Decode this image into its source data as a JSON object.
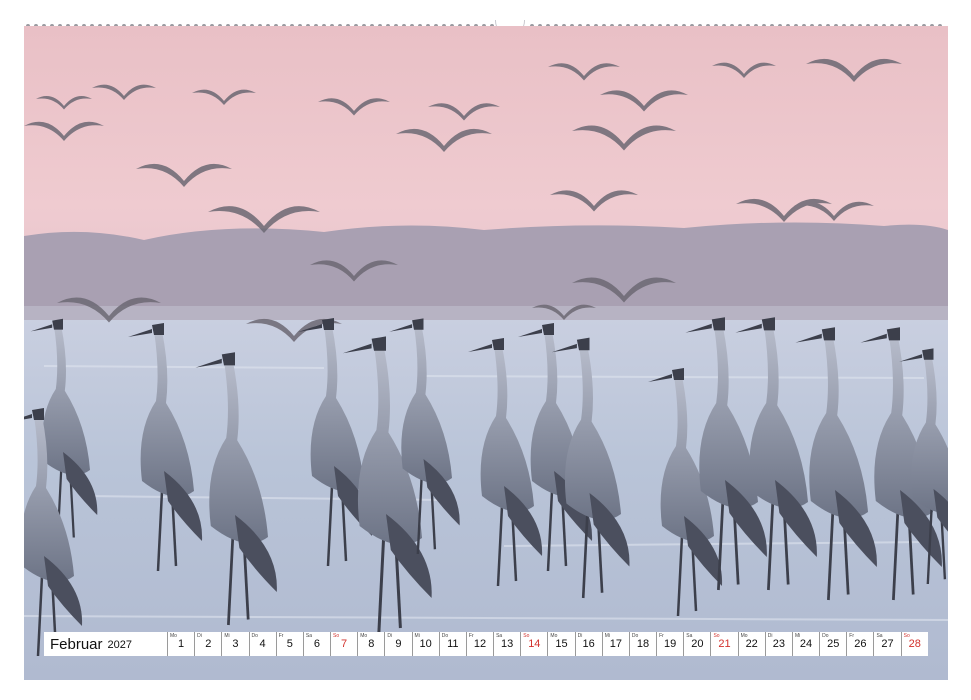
{
  "calendar": {
    "month": "Februar",
    "year": "2027",
    "days": [
      {
        "wd": "Mo",
        "n": "1",
        "sun": false
      },
      {
        "wd": "Di",
        "n": "2",
        "sun": false
      },
      {
        "wd": "Mi",
        "n": "3",
        "sun": false
      },
      {
        "wd": "Do",
        "n": "4",
        "sun": false
      },
      {
        "wd": "Fr",
        "n": "5",
        "sun": false
      },
      {
        "wd": "Sa",
        "n": "6",
        "sun": false
      },
      {
        "wd": "So",
        "n": "7",
        "sun": true
      },
      {
        "wd": "Mo",
        "n": "8",
        "sun": false
      },
      {
        "wd": "Di",
        "n": "9",
        "sun": false
      },
      {
        "wd": "Mi",
        "n": "10",
        "sun": false
      },
      {
        "wd": "Do",
        "n": "11",
        "sun": false
      },
      {
        "wd": "Fr",
        "n": "12",
        "sun": false
      },
      {
        "wd": "Sa",
        "n": "13",
        "sun": false
      },
      {
        "wd": "So",
        "n": "14",
        "sun": true
      },
      {
        "wd": "Mo",
        "n": "15",
        "sun": false
      },
      {
        "wd": "Di",
        "n": "16",
        "sun": false
      },
      {
        "wd": "Mi",
        "n": "17",
        "sun": false
      },
      {
        "wd": "Do",
        "n": "18",
        "sun": false
      },
      {
        "wd": "Fr",
        "n": "19",
        "sun": false
      },
      {
        "wd": "Sa",
        "n": "20",
        "sun": false
      },
      {
        "wd": "So",
        "n": "21",
        "sun": true
      },
      {
        "wd": "Mo",
        "n": "22",
        "sun": false
      },
      {
        "wd": "Di",
        "n": "23",
        "sun": false
      },
      {
        "wd": "Mi",
        "n": "24",
        "sun": false
      },
      {
        "wd": "Do",
        "n": "25",
        "sun": false
      },
      {
        "wd": "Fr",
        "n": "26",
        "sun": false
      },
      {
        "wd": "Sa",
        "n": "27",
        "sun": false
      },
      {
        "wd": "So",
        "n": "28",
        "sun": true
      }
    ]
  },
  "colors": {
    "sky": "#ecc3c8",
    "hills": "#a79fb0",
    "water": "#b9c3d7",
    "crane": "#8e95a6",
    "sunday": "#d2322d"
  }
}
